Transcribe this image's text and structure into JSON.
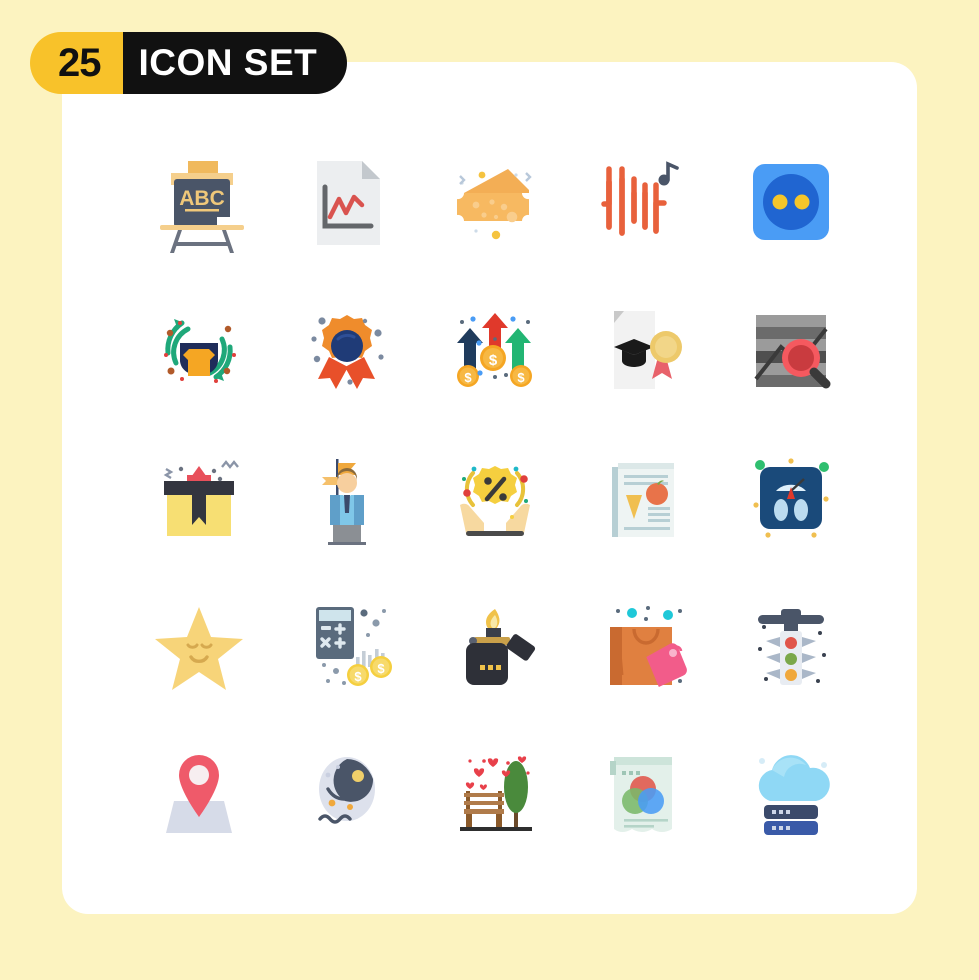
{
  "header": {
    "count": "25",
    "title": "ICON SET",
    "badge_number_bg": "#f8c22a",
    "badge_text_bg": "#111111",
    "badge_number_color": "#111111",
    "badge_text_color": "#ffffff"
  },
  "page": {
    "background": "#fcf3c0",
    "card_background": "#ffffff"
  },
  "grid": {
    "columns": 5,
    "rows": 5,
    "total": 25
  },
  "icons": [
    {
      "index": 1,
      "row": 1,
      "col": 1,
      "name": "blackboard-abc-icon",
      "label": "ABC Blackboard",
      "text": "ABC",
      "colors": [
        "#4a5568",
        "#f0b95d",
        "#f5d393"
      ]
    },
    {
      "index": 2,
      "row": 1,
      "col": 2,
      "name": "chart-document-icon",
      "label": "Chart Document",
      "text": "",
      "colors": [
        "#e8eaec",
        "#d9534f",
        "#6d6d6d"
      ]
    },
    {
      "index": 3,
      "row": 1,
      "col": 3,
      "name": "cheese-wedge-icon",
      "label": "Cheese",
      "text": "",
      "colors": [
        "#f5a93f",
        "#f7b85c",
        "#fbd08a"
      ]
    },
    {
      "index": 4,
      "row": 1,
      "col": 4,
      "name": "audio-waveform-icon",
      "label": "Audio Waveform",
      "text": "",
      "colors": [
        "#e8613c",
        "#4a5568"
      ]
    },
    {
      "index": 5,
      "row": 1,
      "col": 5,
      "name": "power-socket-icon",
      "label": "Power Socket",
      "text": "",
      "colors": [
        "#4a9cf5",
        "#2065d1",
        "#f8c22a"
      ]
    },
    {
      "index": 6,
      "row": 2,
      "col": 1,
      "name": "clothes-recycle-icon",
      "label": "Clothing Recycle",
      "text": "",
      "colors": [
        "#1fa87a",
        "#1f2d5a",
        "#f5a623"
      ]
    },
    {
      "index": 7,
      "row": 2,
      "col": 2,
      "name": "award-badge-icon",
      "label": "Award Badge",
      "text": "",
      "colors": [
        "#ef8c2c",
        "#1f3b77",
        "#e8502a"
      ]
    },
    {
      "index": 8,
      "row": 2,
      "col": 3,
      "name": "money-growth-arrows-icon",
      "label": "Money Growth",
      "text": "$",
      "colors": [
        "#1f3b5c",
        "#e0392b",
        "#22b573",
        "#f5a623"
      ]
    },
    {
      "index": 9,
      "row": 2,
      "col": 4,
      "name": "diploma-certificate-icon",
      "label": "Diploma Certificate",
      "text": "",
      "colors": [
        "#f0f0f0",
        "#1a1a1a",
        "#edc96a",
        "#e8626b"
      ]
    },
    {
      "index": 10,
      "row": 2,
      "col": 5,
      "name": "chart-search-icon",
      "label": "Chart Analysis Search",
      "text": "",
      "colors": [
        "#9b9b9b",
        "#616161",
        "#f0404a"
      ]
    },
    {
      "index": 11,
      "row": 3,
      "col": 1,
      "name": "gift-box-icon",
      "label": "Gift Box",
      "text": "",
      "colors": [
        "#f7df73",
        "#fae98f",
        "#33353f",
        "#e8505b"
      ]
    },
    {
      "index": 12,
      "row": 3,
      "col": 2,
      "name": "leader-flag-icon",
      "label": "Leadership Flag",
      "text": "",
      "colors": [
        "#7fc7e8",
        "#5f9fc9",
        "#3b4a6b",
        "#8b8f94",
        "#f5c06b"
      ]
    },
    {
      "index": 13,
      "row": 3,
      "col": 3,
      "name": "discount-hands-icon",
      "label": "Discount In Hands",
      "text": "%",
      "colors": [
        "#f5cf3f",
        "#f7d9a0",
        "#4a4a4a"
      ]
    },
    {
      "index": 14,
      "row": 3,
      "col": 4,
      "name": "newspaper-article-icon",
      "label": "Newspaper Article",
      "text": "",
      "colors": [
        "#eef4f3",
        "#f0bf50",
        "#e8734a",
        "#b7cfd4"
      ]
    },
    {
      "index": 15,
      "row": 3,
      "col": 5,
      "name": "weight-scale-icon",
      "label": "Weight Scale",
      "text": "",
      "colors": [
        "#1a4a7a",
        "#bcdcf0",
        "#e0392b",
        "#2fbf6f"
      ]
    },
    {
      "index": 16,
      "row": 4,
      "col": 1,
      "name": "smiling-star-icon",
      "label": "Smiling Star",
      "text": "",
      "colors": [
        "#f7d479",
        "#d6a94f"
      ]
    },
    {
      "index": 17,
      "row": 4,
      "col": 2,
      "name": "calculator-coins-icon",
      "label": "Calculator Finance",
      "text": "$",
      "colors": [
        "#5a6b7d",
        "#cfe4ec",
        "#f5cf3f",
        "#c4cdd6"
      ]
    },
    {
      "index": 18,
      "row": 4,
      "col": 3,
      "name": "lighter-flame-icon",
      "label": "Lighter",
      "text": "",
      "colors": [
        "#2e3038",
        "#f0c24a",
        "#f5e08a"
      ]
    },
    {
      "index": 19,
      "row": 4,
      "col": 4,
      "name": "shopping-bag-tag-icon",
      "label": "Shopping Bag Tag",
      "text": "",
      "colors": [
        "#e08040",
        "#c96a30",
        "#f25c8a",
        "#1fc8d8"
      ]
    },
    {
      "index": 20,
      "row": 4,
      "col": 5,
      "name": "traffic-light-icon",
      "label": "Traffic Light",
      "text": "",
      "colors": [
        "#4a5568",
        "#e0554a",
        "#7aa84a",
        "#f0a83c",
        "#c6d0dc"
      ]
    },
    {
      "index": 21,
      "row": 5,
      "col": 1,
      "name": "map-pin-icon",
      "label": "Map Location Pin",
      "text": "",
      "colors": [
        "#ef5a6a",
        "#d6dbe8"
      ]
    },
    {
      "index": 22,
      "row": 5,
      "col": 2,
      "name": "fish-icon",
      "label": "Fish",
      "text": "",
      "colors": [
        "#dde1ec",
        "#4a5568",
        "#f0b95d"
      ]
    },
    {
      "index": 23,
      "row": 5,
      "col": 3,
      "name": "park-bench-love-icon",
      "label": "Park Bench Love",
      "text": "",
      "colors": [
        "#b07b4a",
        "#4a8a3c",
        "#e8404a",
        "#2e2e2e"
      ]
    },
    {
      "index": 24,
      "row": 5,
      "col": 4,
      "name": "color-circles-doc-icon",
      "label": "Color Mix Document",
      "text": "",
      "colors": [
        "#e3f0ea",
        "#e0554a",
        "#4a9cf5",
        "#7ab86a"
      ]
    },
    {
      "index": 25,
      "row": 5,
      "col": 5,
      "name": "cloud-server-icon",
      "label": "Cloud Server",
      "text": "",
      "colors": [
        "#8fd8f5",
        "#a8e2f7",
        "#3b4a6b",
        "#3a5aa8"
      ]
    }
  ]
}
